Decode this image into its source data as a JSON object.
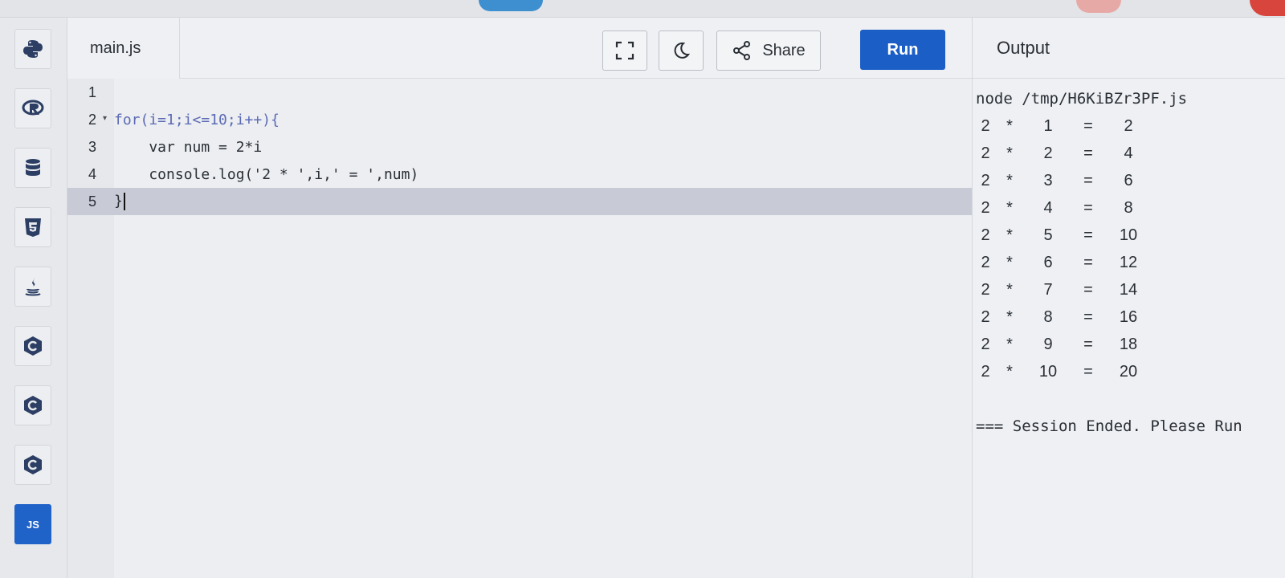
{
  "editor": {
    "file_tab": "main.js",
    "share_label": "Share",
    "run_label": "Run",
    "code_lines": [
      {
        "num": "1",
        "text": ""
      },
      {
        "num": "2",
        "text": "for(i=1;i<=10;i++){"
      },
      {
        "num": "3",
        "text": "    var num = 2*i"
      },
      {
        "num": "4",
        "text": "    console.log('2 * ',i,' = ',num)"
      },
      {
        "num": "5",
        "text": "}"
      }
    ]
  },
  "output": {
    "title": "Output",
    "command": "node /tmp/H6KiBZr3PF.js",
    "rows": [
      [
        "2",
        "*",
        "1",
        "=",
        "2"
      ],
      [
        "2",
        "*",
        "2",
        "=",
        "4"
      ],
      [
        "2",
        "*",
        "3",
        "=",
        "6"
      ],
      [
        "2",
        "*",
        "4",
        "=",
        "8"
      ],
      [
        "2",
        "*",
        "5",
        "=",
        "10"
      ],
      [
        "2",
        "*",
        "6",
        "=",
        "12"
      ],
      [
        "2",
        "*",
        "7",
        "=",
        "14"
      ],
      [
        "2",
        "*",
        "8",
        "=",
        "16"
      ],
      [
        "2",
        "*",
        "9",
        "=",
        "18"
      ],
      [
        "2",
        "*",
        "10",
        "=",
        "20"
      ]
    ],
    "session_text": "=== Session Ended. Please Run"
  },
  "sidebar": {
    "languages": [
      {
        "name": "python-icon"
      },
      {
        "name": "r-icon"
      },
      {
        "name": "sql-icon"
      },
      {
        "name": "html5-icon"
      },
      {
        "name": "java-icon"
      },
      {
        "name": "c-icon"
      },
      {
        "name": "cpp-icon"
      },
      {
        "name": "csharp-icon"
      },
      {
        "name": "javascript-icon",
        "label": "JS"
      }
    ]
  },
  "colors": {
    "accent": "#1b5ec6",
    "active_line": "#c8cad6",
    "keyword": "#5b6ab5"
  }
}
